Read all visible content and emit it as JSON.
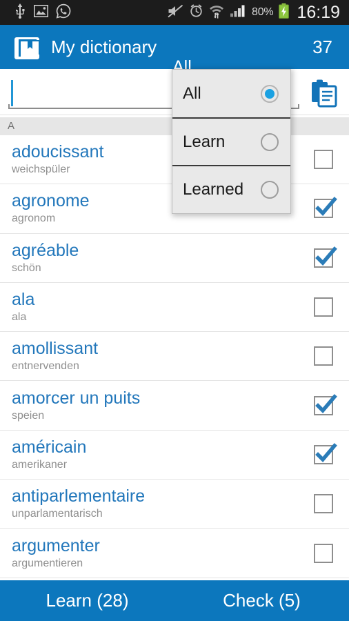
{
  "statusbar": {
    "left_icons": [
      "usb-icon",
      "gallery-icon",
      "whatsapp-icon"
    ],
    "right_icons": [
      "mute-icon",
      "alarm-icon",
      "wifi-icon",
      "signal-icon"
    ],
    "battery_percent": "80%",
    "battery_icon": "battery-charging-icon",
    "clock": "16:19"
  },
  "actionbar": {
    "logo_icon": "book-bookmark-icon",
    "title": "My dictionary",
    "filter_value": "All",
    "word_count": "37"
  },
  "search": {
    "value": "",
    "placeholder": "",
    "paste_icon": "clipboard-paste-icon"
  },
  "section": {
    "letter": "A"
  },
  "words": [
    {
      "term": "adoucissant",
      "translation": "weichspüler",
      "checked": false
    },
    {
      "term": "agronome",
      "translation": "agronom",
      "checked": true
    },
    {
      "term": "agréable",
      "translation": "schön",
      "checked": true
    },
    {
      "term": "ala",
      "translation": "ala",
      "checked": false
    },
    {
      "term": "amollissant",
      "translation": "entnervenden",
      "checked": false
    },
    {
      "term": "amorcer un puits",
      "translation": "speien",
      "checked": true
    },
    {
      "term": "américain",
      "translation": "amerikaner",
      "checked": true
    },
    {
      "term": "antiparlementaire",
      "translation": "unparlamentarisch",
      "checked": false
    },
    {
      "term": "argumenter",
      "translation": "argumentieren",
      "checked": false
    }
  ],
  "dropdown": {
    "open": true,
    "options": [
      {
        "label": "All",
        "selected": true
      },
      {
        "label": "Learn",
        "selected": false
      },
      {
        "label": "Learned",
        "selected": false
      }
    ]
  },
  "bottombar": {
    "learn_label": "Learn (28)",
    "check_label": "Check (5)"
  },
  "colors": {
    "accent": "#0c77bd",
    "term": "#2277bb",
    "translation": "#8e8e8e",
    "statusbar": "#1c1c1c",
    "section_header": "#e6e6e6",
    "radio_on": "#1ba1e2",
    "battery": "#8cc63f"
  }
}
